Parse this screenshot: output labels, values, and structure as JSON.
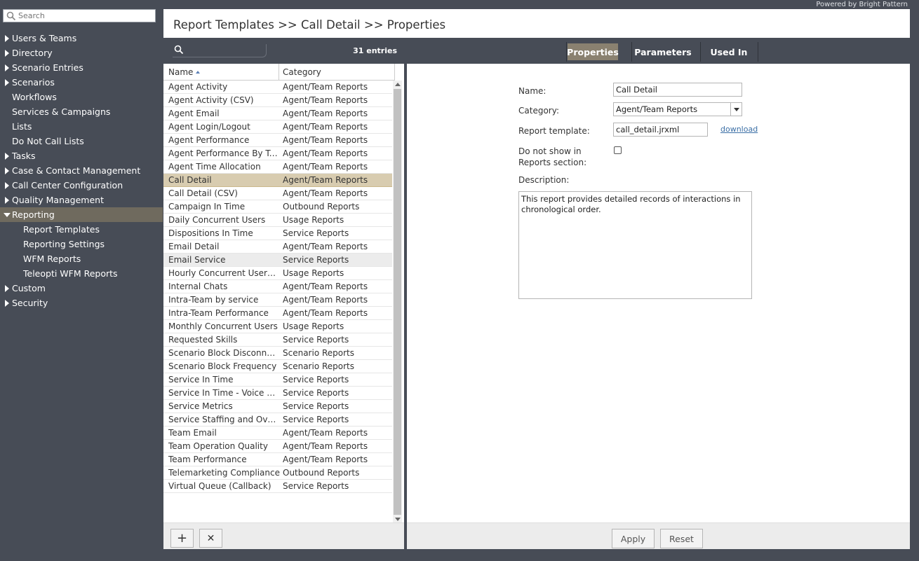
{
  "powered_by": "Powered by Bright Pattern",
  "sidebar": {
    "search_placeholder": "Search",
    "items": [
      {
        "label": "Users & Teams",
        "arrow": "right"
      },
      {
        "label": "Directory",
        "arrow": "right"
      },
      {
        "label": "Scenario Entries",
        "arrow": "right"
      },
      {
        "label": "Scenarios",
        "arrow": "right"
      },
      {
        "label": "Workflows",
        "arrow": "none"
      },
      {
        "label": "Services & Campaigns",
        "arrow": "none"
      },
      {
        "label": "Lists",
        "arrow": "none"
      },
      {
        "label": "Do Not Call Lists",
        "arrow": "none"
      },
      {
        "label": "Tasks",
        "arrow": "right"
      },
      {
        "label": "Case & Contact Management",
        "arrow": "right"
      },
      {
        "label": "Call Center Configuration",
        "arrow": "right"
      },
      {
        "label": "Quality Management",
        "arrow": "right"
      },
      {
        "label": "Reporting",
        "arrow": "down",
        "active": true
      },
      {
        "label": "Report Templates",
        "sub": true
      },
      {
        "label": "Reporting Settings",
        "sub": true
      },
      {
        "label": "WFM Reports",
        "sub": true
      },
      {
        "label": "Teleopti WFM Reports",
        "sub": true
      },
      {
        "label": "Custom",
        "arrow": "right"
      },
      {
        "label": "Security",
        "arrow": "right"
      }
    ]
  },
  "breadcrumb": "Report Templates >> Call Detail >> Properties",
  "list": {
    "entries": "31 entries",
    "headers": {
      "name": "Name",
      "category": "Category"
    },
    "rows": [
      {
        "name": "Agent Activity",
        "category": "Agent/Team Reports"
      },
      {
        "name": "Agent Activity (CSV)",
        "category": "Agent/Team Reports"
      },
      {
        "name": "Agent Email",
        "category": "Agent/Team Reports"
      },
      {
        "name": "Agent Login/Logout",
        "category": "Agent/Team Reports"
      },
      {
        "name": "Agent Performance",
        "category": "Agent/Team Reports"
      },
      {
        "name": "Agent Performance By Te...",
        "category": "Agent/Team Reports"
      },
      {
        "name": "Agent Time Allocation",
        "category": "Agent/Team Reports"
      },
      {
        "name": "Call Detail",
        "category": "Agent/Team Reports",
        "selected": true
      },
      {
        "name": "Call Detail (CSV)",
        "category": "Agent/Team Reports"
      },
      {
        "name": "Campaign In Time",
        "category": "Outbound Reports"
      },
      {
        "name": "Daily Concurrent Users",
        "category": "Usage Reports"
      },
      {
        "name": "Dispositions In Time",
        "category": "Service Reports"
      },
      {
        "name": "Email Detail",
        "category": "Agent/Team Reports"
      },
      {
        "name": "Email Service",
        "category": "Service Reports",
        "hover": true
      },
      {
        "name": "Hourly Concurrent Users ...",
        "category": "Usage Reports"
      },
      {
        "name": "Internal Chats",
        "category": "Agent/Team Reports"
      },
      {
        "name": "Intra-Team by service",
        "category": "Agent/Team Reports"
      },
      {
        "name": "Intra-Team Performance",
        "category": "Agent/Team Reports"
      },
      {
        "name": "Monthly Concurrent Users",
        "category": "Usage Reports"
      },
      {
        "name": "Requested Skills",
        "category": "Service Reports"
      },
      {
        "name": "Scenario Block Disconnects",
        "category": "Scenario Reports"
      },
      {
        "name": "Scenario Block Frequency",
        "category": "Scenario Reports"
      },
      {
        "name": "Service In Time",
        "category": "Service Reports"
      },
      {
        "name": "Service In Time - Voice an...",
        "category": "Service Reports"
      },
      {
        "name": "Service Metrics",
        "category": "Service Reports"
      },
      {
        "name": "Service Staffing and Overf...",
        "category": "Service Reports"
      },
      {
        "name": "Team Email",
        "category": "Agent/Team Reports"
      },
      {
        "name": "Team Operation Quality",
        "category": "Agent/Team Reports"
      },
      {
        "name": "Team Performance",
        "category": "Agent/Team Reports"
      },
      {
        "name": "Telemarketing Compliance",
        "category": "Outbound Reports"
      },
      {
        "name": "Virtual Queue (Callback)",
        "category": "Service Reports"
      }
    ],
    "add_label": "+",
    "delete_label": "✕"
  },
  "tabs": {
    "properties": "Properties",
    "parameters": "Parameters",
    "used_in": "Used In"
  },
  "form": {
    "name_label": "Name:",
    "name_value": "Call Detail",
    "category_label": "Category:",
    "category_value": "Agent/Team Reports",
    "template_label": "Report template:",
    "template_value": "call_detail.jrxml",
    "download_label": "download",
    "hide_label_1": "Do not show in",
    "hide_label_2": "Reports section:",
    "description_label": "Description:",
    "description_value": "This report provides detailed records of interactions in chronological order."
  },
  "buttons": {
    "apply": "Apply",
    "reset": "Reset"
  }
}
